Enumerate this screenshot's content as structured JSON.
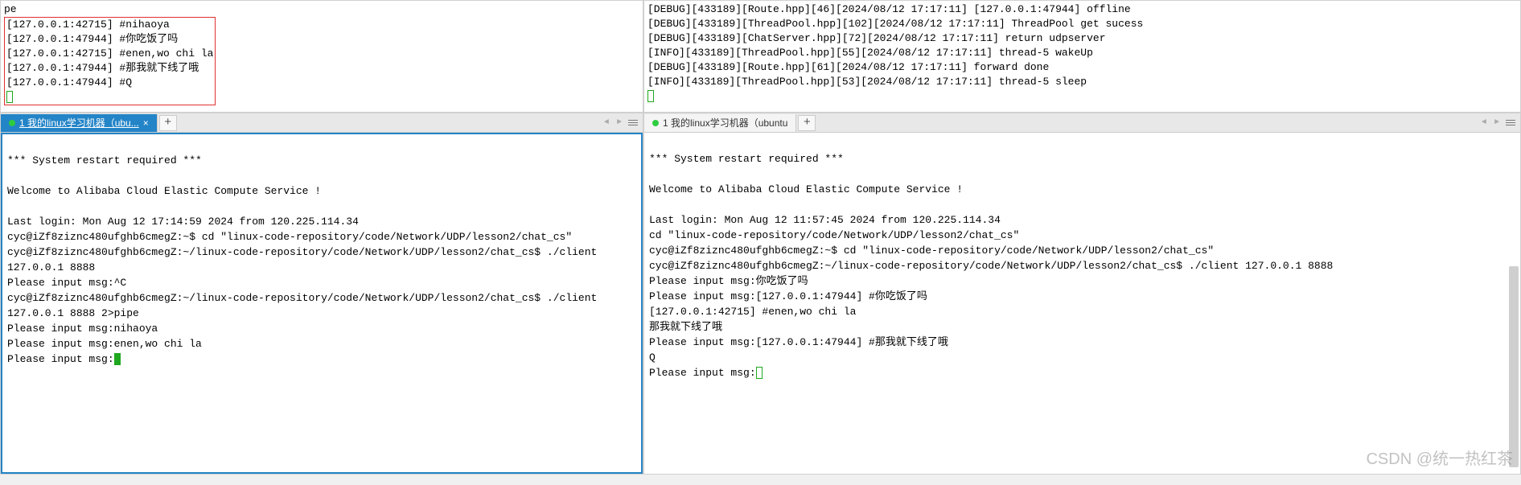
{
  "top_left": {
    "pre_line": "pe",
    "lines": [
      "[127.0.0.1:42715] #nihaoya",
      "[127.0.0.1:47944] #你吃饭了吗",
      "[127.0.0.1:42715] #enen,wo chi la",
      "[127.0.0.1:47944] #那我就下线了哦",
      "[127.0.0.1:47944] #Q"
    ]
  },
  "top_right": {
    "lines": [
      "[DEBUG][433189][Route.hpp][46][2024/08/12 17:17:11] [127.0.0.1:47944] offline",
      "[DEBUG][433189][ThreadPool.hpp][102][2024/08/12 17:17:11] ThreadPool get sucess",
      "[DEBUG][433189][ChatServer.hpp][72][2024/08/12 17:17:11] return udpserver",
      "[INFO][433189][ThreadPool.hpp][55][2024/08/12 17:17:11] thread-5 wakeUp",
      "[DEBUG][433189][Route.hpp][61][2024/08/12 17:17:11] forward done",
      "[INFO][433189][ThreadPool.hpp][53][2024/08/12 17:17:11] thread-5 sleep"
    ]
  },
  "bottom_left": {
    "tab": "1 我的linux学习机器（ubu...",
    "newtab": "+",
    "body": "\n*** System restart required ***\n\nWelcome to Alibaba Cloud Elastic Compute Service !\n\nLast login: Mon Aug 12 17:14:59 2024 from 120.225.114.34\ncyc@iZf8ziznc480ufghb6cmegZ:~$ cd \"linux-code-repository/code/Network/UDP/lesson2/chat_cs\"\ncyc@iZf8ziznc480ufghb6cmegZ:~/linux-code-repository/code/Network/UDP/lesson2/chat_cs$ ./client 127.0.0.1 8888\nPlease input msg:^C\ncyc@iZf8ziznc480ufghb6cmegZ:~/linux-code-repository/code/Network/UDP/lesson2/chat_cs$ ./client 127.0.0.1 8888 2>pipe\nPlease input msg:nihaoya\nPlease input msg:enen,wo chi la\nPlease input msg:"
  },
  "bottom_right": {
    "tab": "1 我的linux学习机器（ubuntu",
    "newtab": "+",
    "body": "\n*** System restart required ***\n\nWelcome to Alibaba Cloud Elastic Compute Service !\n\nLast login: Mon Aug 12 11:57:45 2024 from 120.225.114.34\ncd \"linux-code-repository/code/Network/UDP/lesson2/chat_cs\"\ncyc@iZf8ziznc480ufghb6cmegZ:~$ cd \"linux-code-repository/code/Network/UDP/lesson2/chat_cs\"\ncyc@iZf8ziznc480ufghb6cmegZ:~/linux-code-repository/code/Network/UDP/lesson2/chat_cs$ ./client 127.0.0.1 8888\nPlease input msg:你吃饭了吗\nPlease input msg:[127.0.0.1:47944] #你吃饭了吗\n[127.0.0.1:42715] #enen,wo chi la\n那我就下线了哦\nPlease input msg:[127.0.0.1:47944] #那我就下线了哦\nQ\nPlease input msg:"
  },
  "watermark": "CSDN @统一热红茶"
}
